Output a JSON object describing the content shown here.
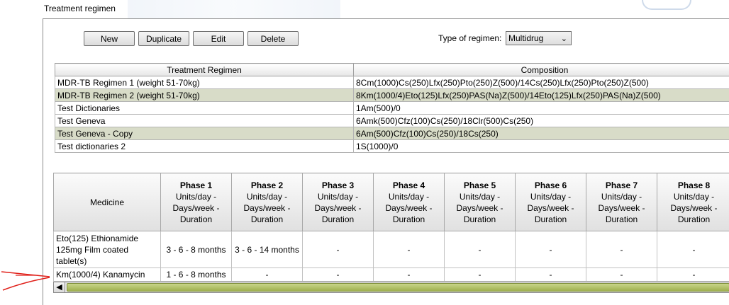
{
  "window": {
    "title": "Treatment regimen"
  },
  "toolbar": {
    "new_label": "New",
    "duplicate_label": "Duplicate",
    "edit_label": "Edit",
    "delete_label": "Delete",
    "type_label": "Type of regimen:",
    "type_value": "Multidrug",
    "type_chevron": "⌄"
  },
  "regimens": {
    "headers": [
      "Treatment Regimen",
      "Composition"
    ],
    "rows": [
      {
        "name": "MDR-TB Regimen 1 (weight 51-70kg)",
        "composition": "8Cm(1000)Cs(250)Lfx(250)Pto(250)Z(500)/14Cs(250)Lfx(250)Pto(250)Z(500)"
      },
      {
        "name": "MDR-TB Regimen 2 (weight 51-70kg)",
        "composition": "8Km(1000/4)Eto(125)Lfx(250)PAS(Na)Z(500)/14Eto(125)Lfx(250)PAS(Na)Z(500)"
      },
      {
        "name": "Test Dictionaries",
        "composition": "1Am(500)/0"
      },
      {
        "name": "Test Geneva",
        "composition": "6Amk(500)Cfz(100)Cs(250)/18Clr(500)Cs(250)"
      },
      {
        "name": "Test Geneva - Copy",
        "composition": "6Am(500)Cfz(100)Cs(250)/18Cs(250)"
      },
      {
        "name": "Test dictionaries 2",
        "composition": "1S(1000)/0"
      }
    ]
  },
  "phases": {
    "medicine_header": "Medicine",
    "phase_sub": [
      "Units/day -",
      "Days/week -",
      "Duration"
    ],
    "phase_names": [
      "Phase 1",
      "Phase 2",
      "Phase 3",
      "Phase 4",
      "Phase 5",
      "Phase 6",
      "Phase 7",
      "Phase 8"
    ],
    "rows": [
      {
        "medicine": [
          "Eto(125)  Ethionamide",
          "125mg  Film coated",
          "tablet(s)"
        ],
        "values": [
          "3 - 6 - 8 months",
          "3 - 6 - 14 months",
          "-",
          "-",
          "-",
          "-",
          "-",
          "-"
        ]
      },
      {
        "medicine": [
          "Km(1000/4)  Kanamycin"
        ],
        "values": [
          "1 - 6 - 8 months",
          "-",
          "-",
          "-",
          "-",
          "-",
          "-",
          "-"
        ]
      }
    ]
  },
  "scroll": {
    "left_arrow": "◀"
  }
}
